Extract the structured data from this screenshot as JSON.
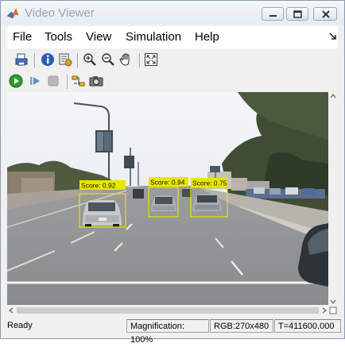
{
  "window": {
    "title": "Video Viewer"
  },
  "menu": {
    "items": [
      "File",
      "Tools",
      "View",
      "Simulation",
      "Help"
    ]
  },
  "toolbar": {
    "icons": [
      "print-icon",
      "info-icon",
      "properties-icon",
      "zoom-in-icon",
      "zoom-out-icon",
      "pan-icon",
      "fit-to-view-icon"
    ],
    "playback_icons": [
      "run-icon",
      "step-forward-icon",
      "stop-icon",
      "highlight-signals-icon",
      "snapshot-icon"
    ]
  },
  "video": {
    "detections": [
      {
        "label": "Score: 0.92"
      },
      {
        "label": "Score: 0.94"
      },
      {
        "label": "Score: 0.75"
      }
    ],
    "box_color": "#e6e600"
  },
  "status": {
    "state": "Ready",
    "magnification": "Magnification: 100%",
    "format": "RGB:270x480",
    "time": "T=411600.000"
  }
}
